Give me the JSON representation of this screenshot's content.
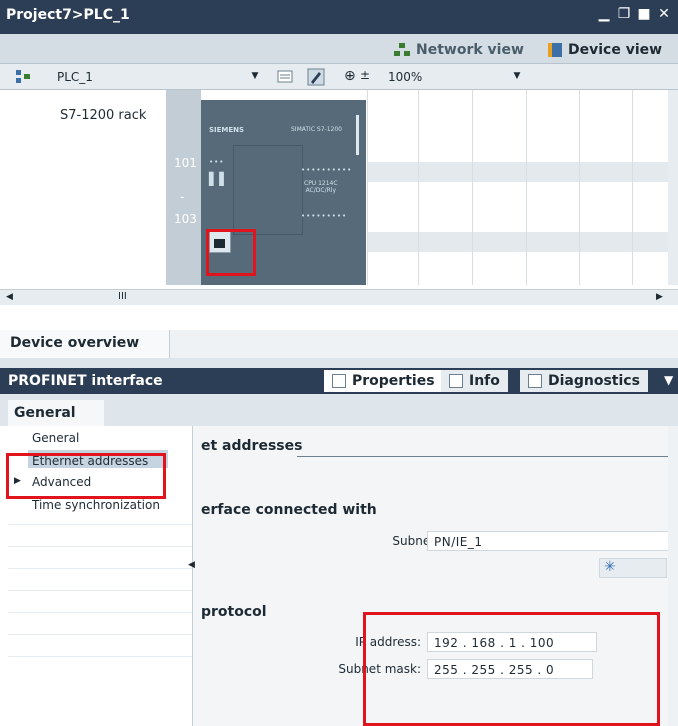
{
  "window": {
    "title": "Project7>PLC_1"
  },
  "views": {
    "network": "Network view",
    "device": "Device view"
  },
  "toolbar": {
    "device_select": "PLC_1",
    "zoom": "100%"
  },
  "canvas": {
    "rack_label": "S7-1200 rack",
    "slots": [
      "101",
      "-",
      "103"
    ],
    "plc_brand": "SIEMENS",
    "plc_model": "SIMATIC S7-1200",
    "plc_cpu": "CPU 1214C\nAC/DC/Rly"
  },
  "overview": {
    "tab": "Device overview"
  },
  "inspector": {
    "title": "PROFINET interface",
    "tabs": [
      "Properties",
      "Info",
      "Diagnostics"
    ],
    "general_tab": "General",
    "nav": [
      "General",
      "Ethernet addresses",
      "Advanced",
      "Time synchronization"
    ],
    "sections": {
      "addresses": "et addresses",
      "connected": "erface connected with",
      "protocol": "protocol"
    },
    "subnet_label": "Subnet:",
    "subnet_value": "PN/IE_1",
    "ip_label": "IP address:",
    "ip_value": "192 . 168 . 1     . 100",
    "mask_label": "Subnet mask:",
    "mask_value": "255 . 255 . 255 . 0"
  },
  "colors": {
    "highlight": "#e1141e",
    "titlebar": "#2c3e55"
  }
}
